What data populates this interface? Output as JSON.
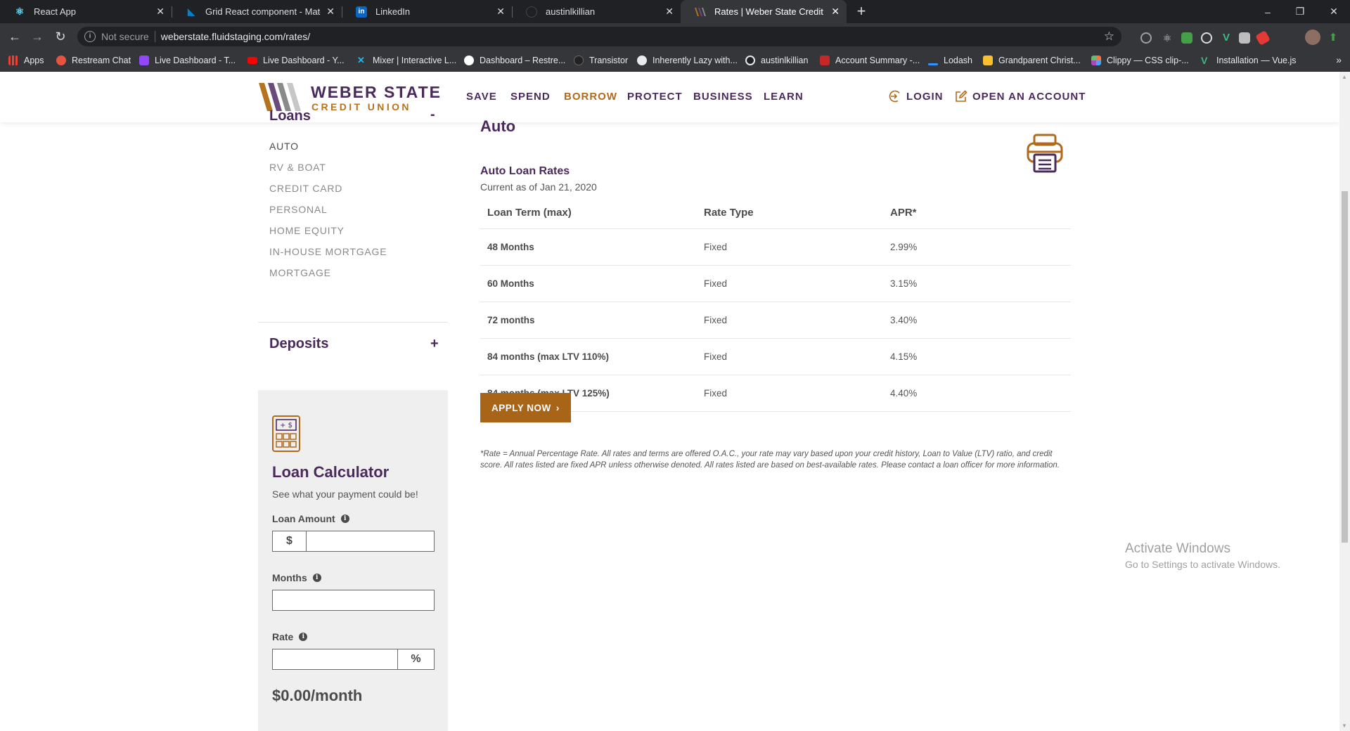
{
  "browser": {
    "tabs": [
      {
        "title": "React App",
        "icon": "react-icon",
        "active": false
      },
      {
        "title": "Grid React component - Material-UI",
        "icon": "material-ui-icon",
        "active": false
      },
      {
        "title": "LinkedIn",
        "icon": "linkedin-icon",
        "active": false
      },
      {
        "title": "austinlkillian",
        "icon": "github-icon",
        "active": false
      },
      {
        "title": "Rates | Weber State Credit Union",
        "icon": "weber-icon",
        "active": true
      }
    ],
    "new_tab": "+",
    "window_controls": {
      "minimize": "–",
      "restore": "❐",
      "close": "✕"
    },
    "address": {
      "security": "Not secure",
      "url": "weberstate.fluidstaging.com/rates/"
    },
    "bookmarks": [
      {
        "label": "Apps",
        "color": "#e8eaed"
      },
      {
        "label": "Restream Chat",
        "color": "#e8533f"
      },
      {
        "label": "Live Dashboard - T...",
        "color": "#9146ff"
      },
      {
        "label": "Live Dashboard - Y...",
        "color": "#ff0000"
      },
      {
        "label": "Mixer | Interactive L...",
        "color": "#1fbaed"
      },
      {
        "label": "Dashboard – Restre...",
        "color": "#ffffff"
      },
      {
        "label": "Transistor",
        "color": "#222222"
      },
      {
        "label": "Inherently Lazy with...",
        "color": "#e8eaed"
      },
      {
        "label": "austinlkillian",
        "color": "#e8eaed"
      },
      {
        "label": "Account Summary -...",
        "color": "#c62828"
      },
      {
        "label": "Lodash",
        "color": "#3492ff"
      },
      {
        "label": "Grandparent Christ...",
        "color": "#fbc02d"
      },
      {
        "label": "Clippy — CSS clip-...",
        "color": "#ff7043"
      },
      {
        "label": "Installation — Vue.js",
        "color": "#41b883"
      }
    ],
    "bookmarks_more": "»"
  },
  "site": {
    "logo": {
      "line1": "WEBER STATE",
      "line2": "CREDIT UNION"
    },
    "nav": [
      "SAVE",
      "SPEND",
      "BORROW",
      "PROTECT",
      "BUSINESS",
      "LEARN"
    ],
    "nav_active": "BORROW",
    "login": "LOGIN",
    "open_account": "OPEN AN ACCOUNT",
    "colors": {
      "brand_purple": "#4a2a5c",
      "brand_gold": "#a86417"
    }
  },
  "sidebar": {
    "loans_heading": "Loans",
    "loans_toggle": "-",
    "loan_links": [
      "AUTO",
      "RV & BOAT",
      "CREDIT CARD",
      "PERSONAL",
      "HOME EQUITY",
      "IN-HOUSE MORTGAGE",
      "MORTGAGE"
    ],
    "deposits_heading": "Deposits",
    "deposits_toggle": "+"
  },
  "calculator": {
    "title": "Loan Calculator",
    "subtitle": "See what your payment could be!",
    "icon_text": "+ $",
    "loan_amount_label": "Loan Amount",
    "loan_amount_prefix": "$",
    "loan_amount_value": "",
    "months_label": "Months",
    "months_value": "",
    "rate_label": "Rate",
    "rate_suffix": "%",
    "rate_value": "",
    "result": "$0.00/month"
  },
  "main": {
    "title": "Auto",
    "rates_heading": "Auto Loan Rates",
    "rates_sub": "Current as of Jan 21, 2020",
    "columns": [
      "Loan Term (max)",
      "Rate Type",
      "APR*"
    ],
    "rows": [
      {
        "term": "48 Months",
        "type": "Fixed",
        "apr": "2.99%"
      },
      {
        "term": "60 Months",
        "type": "Fixed",
        "apr": "3.15%"
      },
      {
        "term": "72 months",
        "type": "Fixed",
        "apr": "3.40%"
      },
      {
        "term": "84 months (max LTV 110%)",
        "type": "Fixed",
        "apr": "4.15%"
      },
      {
        "term": "84 months (max LTV 125%)",
        "type": "Fixed",
        "apr": "4.40%"
      }
    ],
    "apply_label": "APPLY NOW",
    "apply_chevron": "›",
    "disclaimer": "*Rate = Annual Percentage Rate. All rates and terms are offered O.A.C., your rate may vary based upon your credit history, Loan to Value (LTV) ratio, and credit score. All rates listed are fixed APR unless otherwise denoted. All rates listed are based on best-available rates. Please contact a loan officer for more information."
  },
  "watermark": {
    "line1": "Activate Windows",
    "line2": "Go to Settings to activate Windows."
  }
}
